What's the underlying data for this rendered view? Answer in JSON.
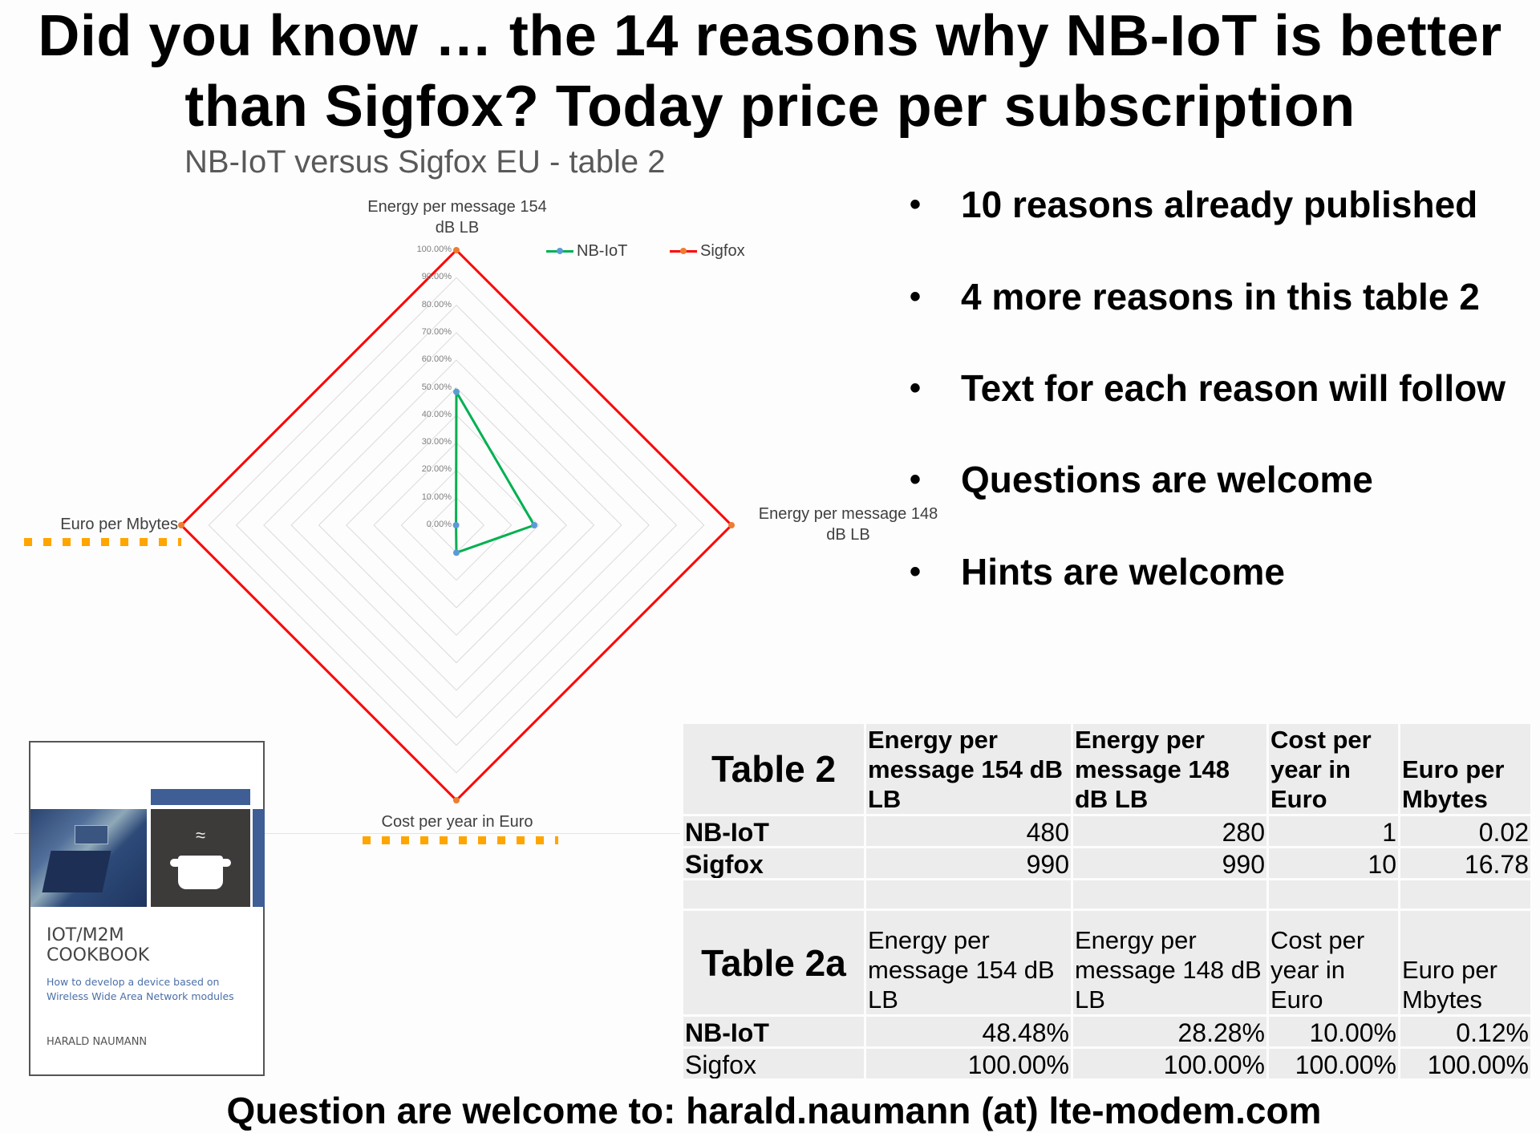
{
  "header": {
    "title_line1": "Did you know … the 14 reasons why NB-IoT is better",
    "title_line2": "than Sigfox? Today price per subscription"
  },
  "chart_data": {
    "type": "radar",
    "title": "NB-IoT versus Sigfox EU - table 2",
    "axes": [
      {
        "label_line1": "Energy per message 154",
        "label_line2": "dB LB"
      },
      {
        "label_line1": "Energy per message 148",
        "label_line2": "dB LB"
      },
      {
        "label_line1": "Cost per year in Euro",
        "label_line2": ""
      },
      {
        "label_line1": "Euro per Mbytes",
        "label_line2": ""
      }
    ],
    "radial_ticks": [
      "0.00%",
      "10.00%",
      "20.00%",
      "30.00%",
      "40.00%",
      "50.00%",
      "60.00%",
      "70.00%",
      "80.00%",
      "90.00%",
      "100.00%"
    ],
    "rlim": [
      0,
      100
    ],
    "grid": true,
    "legend_position": "top-right",
    "series": [
      {
        "name": "NB-IoT",
        "values": [
          48.48,
          28.28,
          10.0,
          0.12
        ],
        "line_color": "#00b050",
        "marker_color": "#5b9bd5"
      },
      {
        "name": "Sigfox",
        "values": [
          100.0,
          100.0,
          100.0,
          100.0
        ],
        "line_color": "#ff0000",
        "marker_color": "#ed7d31"
      }
    ]
  },
  "bullets": [
    "10 reasons already published",
    "4 more reasons in this table 2",
    "Text for each reason will follow",
    "Questions are welcome",
    "Hints are welcome"
  ],
  "bullet_symbol": "•",
  "highlight_color": "#ffa500",
  "table2": {
    "title": "Table 2",
    "columns": [
      "Energy per message 154 dB LB",
      "Energy per message 148 dB LB",
      "Cost per year in Euro",
      "Euro per Mbytes"
    ],
    "columns_display": [
      [
        "Energy per",
        "message 154 dB",
        "LB"
      ],
      [
        "Energy per",
        "message 148",
        "dB LB"
      ],
      [
        "Cost per",
        "year in",
        "Euro"
      ],
      [
        "Euro per",
        "Mbytes"
      ]
    ],
    "rows": [
      {
        "label": "NB-IoT",
        "values": [
          "480",
          "280",
          "1",
          "0.02"
        ]
      },
      {
        "label": "Sigfox",
        "values": [
          "990",
          "990",
          "10",
          "16.78"
        ]
      }
    ]
  },
  "table2a": {
    "title": "Table 2a",
    "columns_display": [
      [
        "Energy per",
        "message 154 dB",
        "LB"
      ],
      [
        "Energy per",
        "message 148 dB",
        "LB"
      ],
      [
        "Cost per",
        "year in",
        "Euro"
      ],
      [
        "Euro per",
        "Mbytes"
      ]
    ],
    "rows": [
      {
        "label": "NB-IoT",
        "values": [
          "48.48%",
          "28.28%",
          "10.00%",
          "0.12%"
        ]
      },
      {
        "label": "Sigfox",
        "values": [
          "100.00%",
          "100.00%",
          "100.00%",
          "100.00%"
        ]
      }
    ]
  },
  "book": {
    "title_line1": "IOT/M2M",
    "title_line2": "COOKBOOK",
    "subtitle_line1": "How to develop a device based on",
    "subtitle_line2": "Wireless Wide Area Network modules",
    "author": "HARALD NAUMANN",
    "steam_text": "≈"
  },
  "footer": {
    "text": "Question are welcome to: harald.naumann (at) lte-modem.com"
  }
}
